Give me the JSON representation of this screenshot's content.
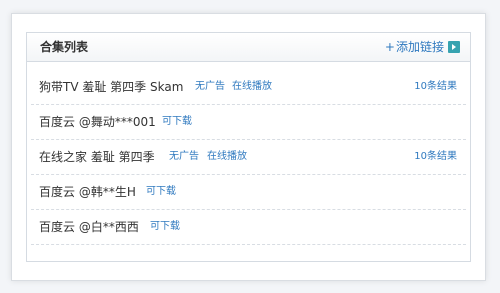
{
  "panel": {
    "title": "合集列表",
    "add_link": {
      "prefix": "+",
      "label": "添加链接"
    }
  },
  "rows": [
    {
      "name": "狗带TV 羞耻 第四季 Skam",
      "tags": [
        "无广告",
        "在线播放"
      ],
      "count": "10条结果"
    },
    {
      "name": "百度云 @舞动***001",
      "tags": [
        "可下载"
      ],
      "count": ""
    },
    {
      "name": "在线之家 羞耻 第四季",
      "tags": [
        "无广告",
        "在线播放"
      ],
      "count": "10条结果"
    },
    {
      "name": "百度云 @韩**生H",
      "tags": [
        "可下载"
      ],
      "count": ""
    },
    {
      "name": "百度云 @白**西西",
      "tags": [
        "可下载"
      ],
      "count": ""
    }
  ],
  "icons": {
    "add_arrow": "chevron-right-icon"
  },
  "colors": {
    "link_blue": "#2f79bf",
    "arrow_teal": "#37a3b0",
    "text_dark": "#333333"
  }
}
